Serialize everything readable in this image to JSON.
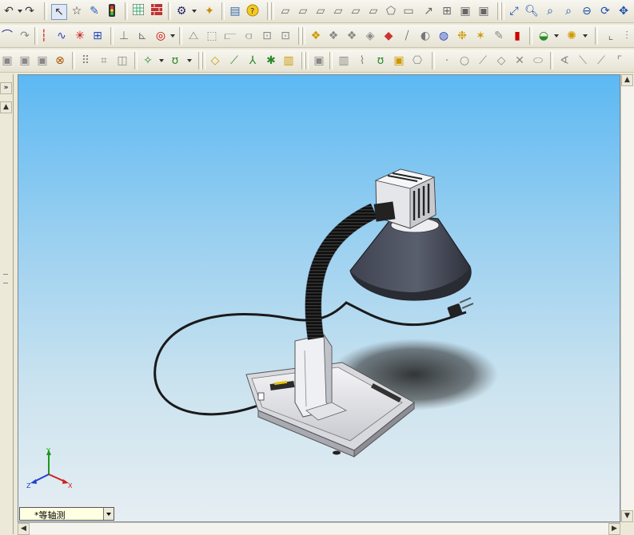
{
  "toolbar_rows": [
    {
      "icons": [
        "undo-icon",
        "redo-icon",
        "select-arrow-icon",
        "smart-select-icon",
        "rebuild-icon",
        "traffic-light-icon",
        "grid-icon",
        "brick-icon",
        "options-icon",
        "customize-icon",
        "properties-icon",
        "help-icon",
        "view-orientation-icon",
        "view-front-icon",
        "view-back-icon",
        "view-left-icon",
        "view-right-icon",
        "view-top-icon",
        "view-bottom-icon",
        "view-iso-icon",
        "view-trimetric-icon",
        "view-dimetric-icon",
        "normal-to-icon",
        "zoom-fit-icon",
        "zoom-area-icon",
        "zoom-in-out-icon",
        "zoom-selection-icon",
        "zoom-out-icon",
        "rotate-icon",
        "pan-icon"
      ]
    },
    {
      "icons": [
        "arc-icon",
        "centerpoint-arc-icon",
        "centerline-icon",
        "spline-icon",
        "point-icon",
        "grid-sketch-icon",
        "relations-icon",
        "dimension-icon",
        "circle-dim-icon",
        "sketch-fillet-icon",
        "offset-icon",
        "trim-icon",
        "extend-icon",
        "mirror-icon",
        "linear-pattern-icon",
        "cosmetic-thread-icon",
        "surface-icon",
        "weld-icon",
        "part-color-icon",
        "material-icon",
        "decal-icon",
        "render-icon",
        "appearance-icon",
        "scene-icon",
        "light-icon",
        "camera-icon",
        "photoworks-icon",
        "settings-icon"
      ]
    },
    {
      "icons": [
        "shaded-icon",
        "hidden-lines-icon",
        "wireframe-icon",
        "perspective-icon",
        "section-view-icon",
        "shadows-icon",
        "reference-point-icon",
        "curve-icon",
        "axis-icon",
        "plane-icon",
        "coordinate-icon",
        "split-line-icon",
        "projected-curve-icon",
        "helix-icon",
        "composite-curve-icon",
        "point-sketch-icon",
        "circle-sketch-icon",
        "line-sketch-icon",
        "polygon-icon",
        "x-mark-icon",
        "slot-icon",
        "angle-icon",
        "line-angle-icon"
      ]
    }
  ],
  "panel_toggle": "»",
  "view_orientation": {
    "label": "*等轴测"
  },
  "triad": {
    "x": "X",
    "y": "Y",
    "z": "Z"
  },
  "colors": {
    "viewport_top": "#5cb8f3",
    "viewport_bottom": "#e6eef2",
    "lamp_shade": "#4a4e5a",
    "lamp_base": "#e8e8ea",
    "neck": "#1e1e1e"
  }
}
